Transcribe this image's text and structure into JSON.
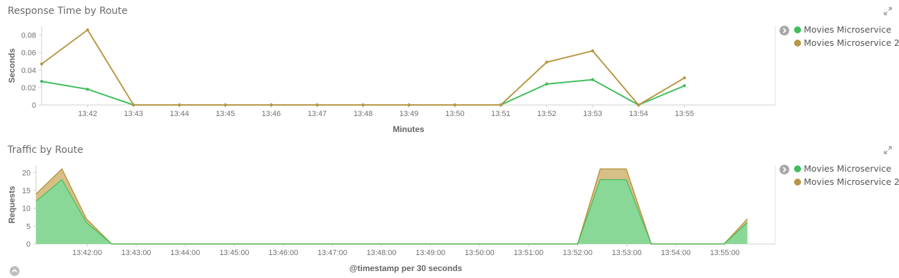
{
  "colors": {
    "series1": "#3fbe5c",
    "series2": "#b89746",
    "area1": "#8ad897",
    "area2": "#d8bf87",
    "axis": "#666666",
    "grid": "#cccccc"
  },
  "icons": {
    "expand": "expand-arrows-icon",
    "legend_toggle": "chevron-right-icon",
    "collapse": "chevron-up-icon"
  },
  "panels": [
    {
      "title": "Response Time by Route",
      "legend": [
        {
          "label": "Movies Microservice",
          "color": "#3fbe5c"
        },
        {
          "label": "Movies Microservice 2",
          "color": "#b89746"
        }
      ]
    },
    {
      "title": "Traffic by Route",
      "legend": [
        {
          "label": "Movies Microservice",
          "color": "#3fbe5c"
        },
        {
          "label": "Movies Microservice 2",
          "color": "#b89746"
        }
      ]
    }
  ],
  "chart_data": [
    {
      "type": "line",
      "title": "Response Time by Route",
      "xlabel": "Minutes",
      "ylabel": "Seconds",
      "x": [
        0,
        1,
        2,
        3,
        4,
        5,
        6,
        7,
        8,
        9,
        10,
        11,
        12,
        13,
        14
      ],
      "x_ticks": [
        "13:42",
        "13:43",
        "13:44",
        "13:45",
        "13:46",
        "13:47",
        "13:48",
        "13:49",
        "13:50",
        "13:51",
        "13:52",
        "13:53",
        "13:54",
        "13:55"
      ],
      "xlim": [
        -1,
        14.98
      ],
      "y_ticks": [
        "0",
        "0.02",
        "0.04",
        "0.06",
        "0.08"
      ],
      "ylim": [
        0,
        0.09
      ],
      "grid": false,
      "legend_position": "right",
      "series": [
        {
          "name": "Movies Microservice",
          "color": "#3fbe5c",
          "x": [
            -1,
            0,
            1,
            2,
            3,
            4,
            5,
            6,
            7,
            8,
            9,
            10,
            11,
            12,
            13
          ],
          "values": [
            0.027,
            0.018,
            0,
            0,
            0,
            0,
            0,
            0,
            0,
            0,
            0,
            0.024,
            0.029,
            0,
            0.022
          ]
        },
        {
          "name": "Movies Microservice 2",
          "color": "#b89746",
          "x": [
            -1,
            0,
            1,
            2,
            3,
            4,
            5,
            6,
            7,
            8,
            9,
            10,
            11,
            12,
            13
          ],
          "values": [
            0.047,
            0.086,
            0,
            0,
            0,
            0,
            0,
            0,
            0,
            0,
            0,
            0.049,
            0.062,
            0,
            0.031
          ]
        }
      ]
    },
    {
      "type": "area",
      "stacked": true,
      "title": "Traffic by Route",
      "xlabel": "@timestamp per 30 seconds",
      "ylabel": "Requests",
      "x_ticks": [
        "13:42:00",
        "13:43:00",
        "13:44:00",
        "13:45:00",
        "13:46:00",
        "13:47:00",
        "13:48:00",
        "13:49:00",
        "13:50:00",
        "13:51:00",
        "13:52:00",
        "13:53:00",
        "13:54:00",
        "13:55:00"
      ],
      "x_tick_positions": [
        1,
        3,
        5,
        7,
        9,
        11,
        13,
        15,
        17,
        19,
        21,
        23,
        25,
        27
      ],
      "xlim": [
        -1.08,
        29.06
      ],
      "y_ticks": [
        "0",
        "5",
        "10",
        "15",
        "20"
      ],
      "ylim": [
        0,
        22
      ],
      "grid": false,
      "legend_position": "right",
      "x": [
        -1.08,
        -0.03,
        0.97,
        2,
        3,
        4,
        5,
        6,
        7,
        8,
        9,
        10,
        11,
        12,
        13,
        14,
        15,
        16,
        17,
        18,
        19,
        20,
        21,
        21.92,
        22.98,
        24,
        25,
        26,
        26.97,
        27.92
      ],
      "series": [
        {
          "name": "Movies Microservice",
          "color": "#3fbe5c",
          "fill": "#8ad897",
          "values": [
            12,
            18,
            6,
            0,
            0,
            0,
            0,
            0,
            0,
            0,
            0,
            0,
            0,
            0,
            0,
            0,
            0,
            0,
            0,
            0,
            0,
            0,
            0,
            18,
            18,
            0,
            0,
            0,
            0,
            6
          ]
        },
        {
          "name": "Movies Microservice 2",
          "color": "#b89746",
          "fill": "#d8bf87",
          "values": [
            2,
            3,
            1,
            0,
            0,
            0,
            0,
            0,
            0,
            0,
            0,
            0,
            0,
            0,
            0,
            0,
            0,
            0,
            0,
            0,
            0,
            0,
            0,
            3,
            3,
            0,
            0,
            0,
            0,
            1
          ]
        }
      ]
    }
  ]
}
